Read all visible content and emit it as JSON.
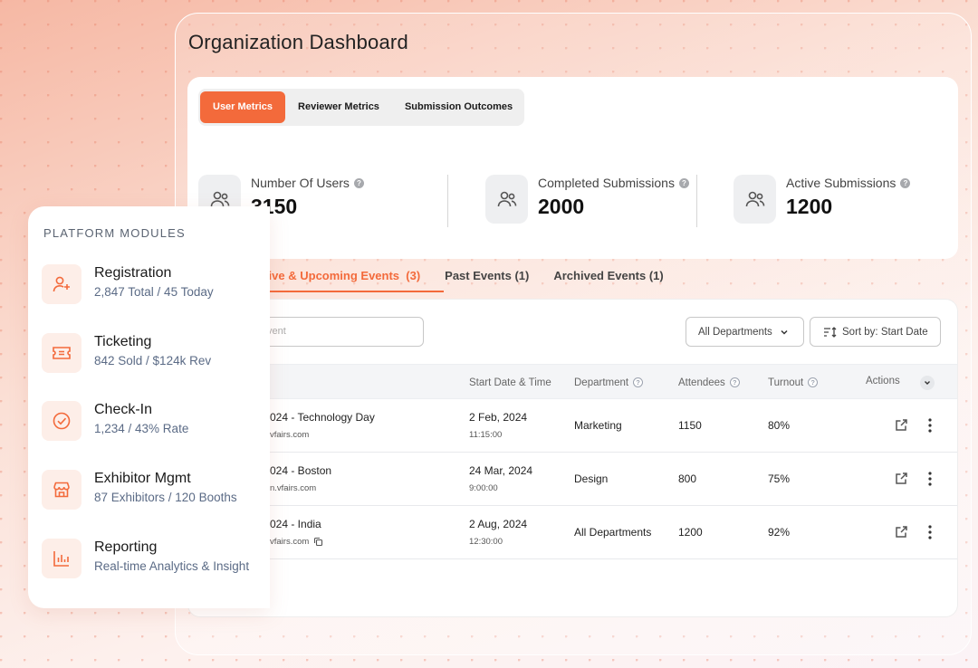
{
  "page": {
    "title": "Organization Dashboard"
  },
  "metric_tabs": [
    "User Metrics",
    "Reviewer Metrics",
    "Submission Outcomes"
  ],
  "metrics": [
    {
      "label": "Number Of Users",
      "value": "3150"
    },
    {
      "label": "Completed Submissions",
      "value": "2000"
    },
    {
      "label": "Active Submissions",
      "value": "1200"
    }
  ],
  "event_tabs": [
    "ctive & Upcoming Events  (3)",
    "Past Events (1)",
    "Archived Events (1)"
  ],
  "filters": {
    "search_placeholder": "vent",
    "department": "All Departments",
    "sort": "Sort by: Start Date"
  },
  "table": {
    "headers": {
      "start": "Start Date & Time",
      "department": "Department",
      "attendees": "Attendees",
      "turnout": "Turnout",
      "actions": "Actions"
    },
    "rows": [
      {
        "name": "024 - Technology Day",
        "url": "vfairs.com",
        "date": "2 Feb, 2024",
        "time": "11:15:00",
        "department": "Marketing",
        "attendees": "1150",
        "turnout": "80%"
      },
      {
        "name": "024 - Boston",
        "url": "n.vfairs.com",
        "date": "24 Mar, 2024",
        "time": "9:00:00",
        "department": "Design",
        "attendees": "800",
        "turnout": "75%"
      },
      {
        "name": "024 - India",
        "url": "vfairs.com",
        "date": "2 Aug, 2024",
        "time": "12:30:00",
        "department": "All Departments",
        "attendees": "1200",
        "turnout": "92%"
      }
    ]
  },
  "modules": {
    "title": "PLATFORM MODULES",
    "items": [
      {
        "name": "Registration",
        "desc": "2,847 Total / 45 Today",
        "icon": "user-plus-icon"
      },
      {
        "name": "Ticketing",
        "desc": "842 Sold / $124k Rev",
        "icon": "ticket-icon"
      },
      {
        "name": "Check-In",
        "desc": "1,234 / 43% Rate",
        "icon": "check-circle-icon"
      },
      {
        "name": "Exhibitor Mgmt",
        "desc": "87 Exhibitors / 120 Booths",
        "icon": "store-icon"
      },
      {
        "name": "Reporting",
        "desc": "Real-time Analytics & Insight",
        "icon": "bar-chart-icon"
      }
    ]
  },
  "colors": {
    "accent": "#f36a3b",
    "icon_bg": "#fdeee8",
    "muted_text": "#5b6b86"
  }
}
